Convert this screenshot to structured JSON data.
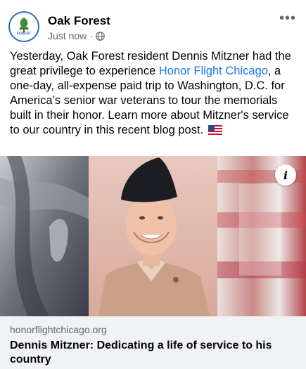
{
  "post": {
    "page_name": "Oak Forest",
    "timestamp": "Just now",
    "separator": "·",
    "privacy_icon": "globe-icon",
    "more_icon": "more-options-icon",
    "caption_part1": "Yesterday, Oak Forest resident Dennis Mitzner had the great privilege to experience ",
    "caption_link": "Honor Flight Chicago",
    "caption_part2": ", a one-day, all-expense paid trip to Washington, D.C. for America’s senior war veterans to tour the memorials built in their honor. Learn more about Mitzner's service to our country in this recent blog post.",
    "caption_emoji": "us-flag-emoji"
  },
  "avatar": {
    "logo_text_top": "OAK",
    "logo_text_bottom": "FOREST"
  },
  "media": {
    "info_label": "i"
  },
  "link_preview": {
    "domain": "honorflightchicago.org",
    "title": "Dennis Mitzner: Dedicating a life of service to his country"
  },
  "colors": {
    "link": "#1877f2",
    "secondary_text": "#65676b",
    "card_background": "#f0f2f5",
    "avatar_ring": "#2f6db3"
  }
}
